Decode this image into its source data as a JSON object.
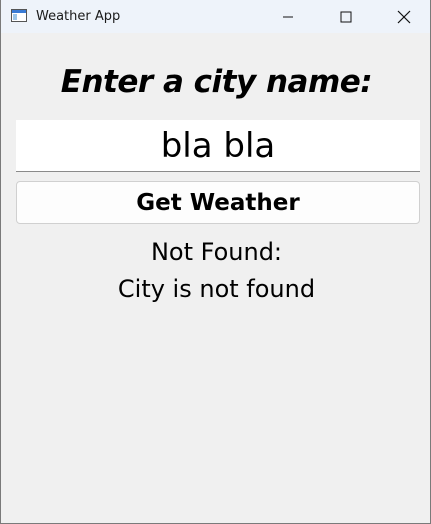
{
  "window": {
    "title": "Weather App"
  },
  "main": {
    "heading": "Enter a city name:",
    "city_input": {
      "value": "bla bla",
      "placeholder": ""
    },
    "get_weather_label": "Get Weather",
    "result": {
      "line1": "Not Found:",
      "line2": "City is not found"
    }
  },
  "icons": {
    "app": "app-window-icon",
    "minimize": "minimize-icon",
    "maximize": "maximize-icon",
    "close": "close-icon"
  },
  "colors": {
    "titlebar": "#eef3fa",
    "background": "#f0f0f0",
    "input_background": "#ffffff",
    "button_background": "#fdfdfd"
  }
}
